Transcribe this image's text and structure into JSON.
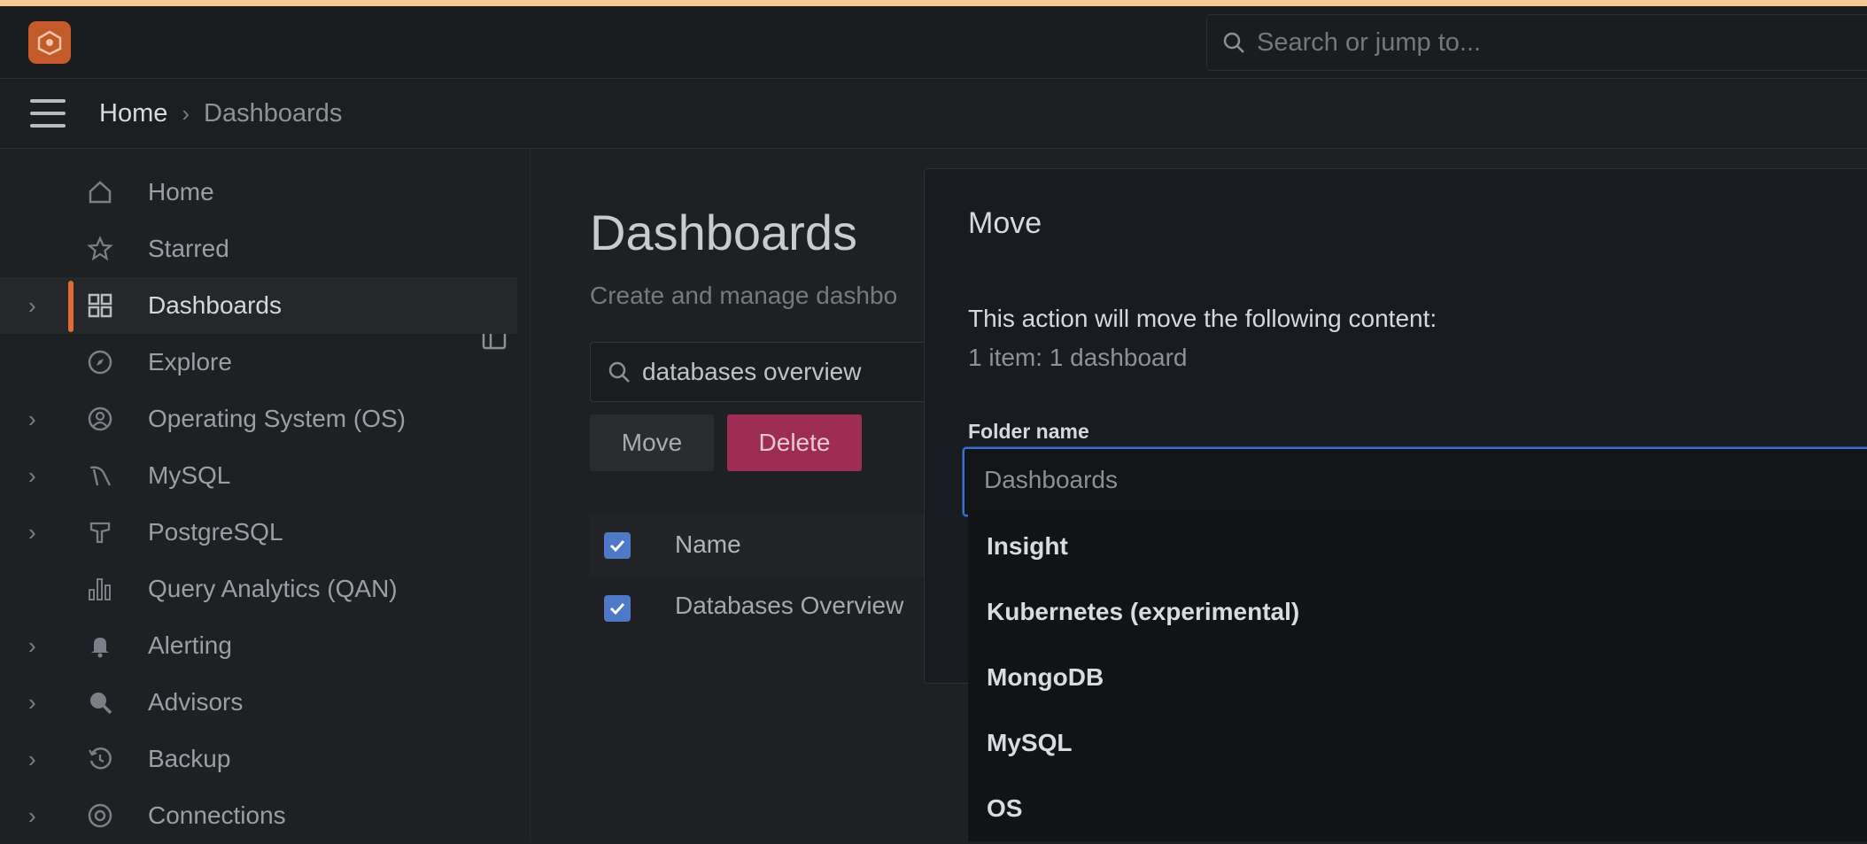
{
  "app": {
    "logo_icon": "pmm-logo-icon",
    "search_placeholder": "Search or jump to..."
  },
  "breadcrumb": {
    "home": "Home",
    "separator": "›",
    "current": "Dashboards"
  },
  "sidebar": {
    "items": [
      {
        "label": "Home",
        "icon": "home-icon",
        "expandable": false,
        "active": false
      },
      {
        "label": "Starred",
        "icon": "star-icon",
        "expandable": false,
        "active": false
      },
      {
        "label": "Dashboards",
        "icon": "apps-grid-icon",
        "expandable": true,
        "active": true
      },
      {
        "label": "Explore",
        "icon": "compass-icon",
        "expandable": false,
        "active": false
      },
      {
        "label": "Operating System (OS)",
        "icon": "os-icon",
        "expandable": true,
        "active": false
      },
      {
        "label": "MySQL",
        "icon": "mysql-icon",
        "expandable": true,
        "active": false
      },
      {
        "label": "PostgreSQL",
        "icon": "postgresql-icon",
        "expandable": true,
        "active": false
      },
      {
        "label": "Query Analytics (QAN)",
        "icon": "qan-bars-icon",
        "expandable": false,
        "active": false
      },
      {
        "label": "Alerting",
        "icon": "bell-icon",
        "expandable": true,
        "active": false
      },
      {
        "label": "Advisors",
        "icon": "advisors-icon",
        "expandable": true,
        "active": false
      },
      {
        "label": "Backup",
        "icon": "backup-icon",
        "expandable": true,
        "active": false
      },
      {
        "label": "Connections",
        "icon": "connections-icon",
        "expandable": true,
        "active": false
      }
    ]
  },
  "main": {
    "title": "Dashboards",
    "subtitle": "Create and manage dashbo",
    "search_value": "databases overview",
    "move_label": "Move",
    "delete_label": "Delete",
    "table": {
      "header_name": "Name",
      "rows": [
        {
          "name": "Databases Overview",
          "checked": true
        }
      ]
    }
  },
  "modal": {
    "title": "Move",
    "line1": "This action will move the following content:",
    "line2": "1 item: 1 dashboard",
    "folder_label": "Folder name",
    "folder_placeholder": "Dashboards",
    "options": [
      "Insight",
      "Kubernetes (experimental)",
      "MongoDB",
      "MySQL",
      "OS"
    ]
  },
  "colors": {
    "accent": "#e06c3a",
    "delete": "#9e2d54",
    "focus": "#3c6fd0",
    "checkbox": "#4d79c7"
  }
}
